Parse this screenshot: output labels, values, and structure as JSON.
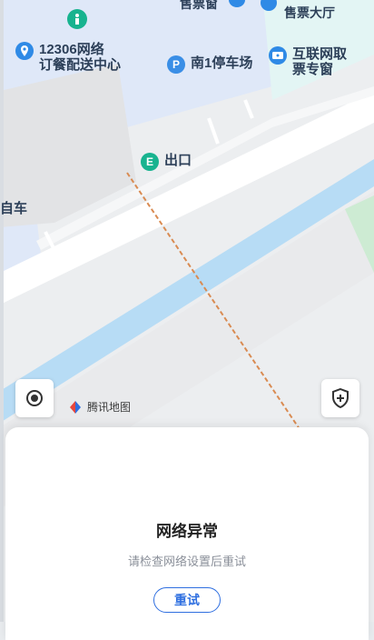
{
  "map": {
    "pois": [
      {
        "name": "12306网络\n订餐配送中心",
        "icon": "location-pin-icon",
        "color": "#2f8ae6"
      },
      {
        "name": "南1停车场",
        "icon": "parking-icon",
        "color": "#3a8ee6",
        "glyph": "P"
      },
      {
        "name": "互联网取\n票专窗",
        "icon": "ticket-icon",
        "color": "#2f8ae6"
      },
      {
        "name": "出口",
        "icon": "exit-icon",
        "color": "#17b38f",
        "glyph": "E"
      }
    ],
    "partial_labels": {
      "top_center": "售票窗",
      "top_right": "售票大厅",
      "left_edge": "自车"
    },
    "attribution": "腾讯地图",
    "buttons": {
      "locate": "locate-button",
      "shield": "safety-shield-button"
    }
  },
  "error_sheet": {
    "title": "网络异常",
    "subtitle": "请检查网络设置后重试",
    "retry_label": "重试"
  },
  "colors": {
    "accent": "#2f6fe0",
    "water": "#b7dcf5",
    "road": "#ffffff",
    "building": "#dfe8f8"
  }
}
